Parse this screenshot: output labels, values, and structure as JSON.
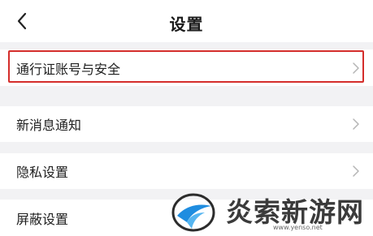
{
  "header": {
    "title": "设置",
    "back_icon": "chevron-left-icon"
  },
  "settings": {
    "items": [
      {
        "label": "通行证账号与安全",
        "icon": "chevron-right-icon"
      },
      {
        "label": "新消息通知",
        "icon": "chevron-right-icon"
      },
      {
        "label": "隐私设置",
        "icon": "chevron-right-icon"
      },
      {
        "label": "屏蔽设置",
        "icon": "chevron-right-icon"
      }
    ]
  },
  "highlight": {
    "color": "#d42e2b"
  },
  "watermark": {
    "brand": "炎索新游网",
    "url": "www.yenso.net",
    "logo": "yenso-logo"
  },
  "colors": {
    "background": "#f2f2f4",
    "row": "#ffffff",
    "text": "#1f1f1f",
    "chevron": "#b5b5b5"
  }
}
